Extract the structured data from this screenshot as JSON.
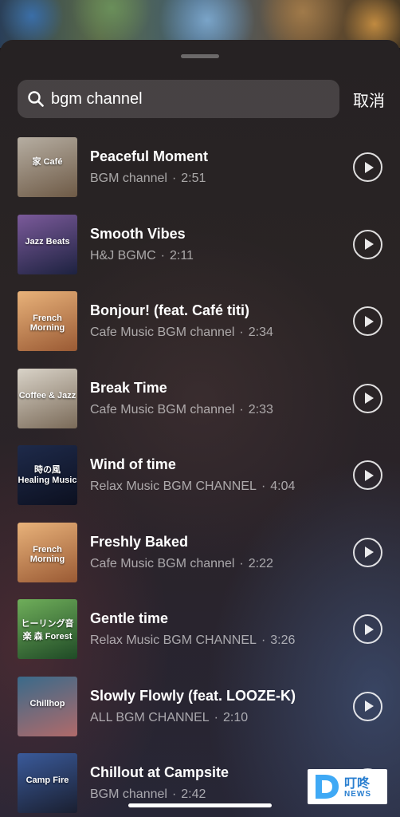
{
  "search": {
    "query": "bgm channel",
    "cancel_label": "取消"
  },
  "songs": [
    {
      "title": "Peaceful Moment",
      "artist": "BGM channel",
      "duration": "2:51",
      "cover_text": "家 Café",
      "cover_colors": [
        "#b6aea2",
        "#6e5a46"
      ]
    },
    {
      "title": "Smooth Vibes",
      "artist": "H&J BGMC",
      "duration": "2:11",
      "cover_text": "Jazz Beats",
      "cover_colors": [
        "#7b5a9a",
        "#1d2240"
      ]
    },
    {
      "title": "Bonjour! (feat. Café titi)",
      "artist": "Cafe Music BGM channel",
      "duration": "2:34",
      "cover_text": "French Morning",
      "cover_colors": [
        "#e8b27a",
        "#9a5a34"
      ]
    },
    {
      "title": "Break Time",
      "artist": "Cafe Music BGM channel",
      "duration": "2:33",
      "cover_text": "Coffee & Jazz",
      "cover_colors": [
        "#d9d3c8",
        "#7a6a58"
      ]
    },
    {
      "title": "Wind of time",
      "artist": "Relax Music BGM CHANNEL",
      "duration": "4:04",
      "cover_text": "時の風 Healing Music",
      "cover_colors": [
        "#1e2a4a",
        "#0c1020"
      ]
    },
    {
      "title": "Freshly Baked",
      "artist": "Cafe Music BGM channel",
      "duration": "2:22",
      "cover_text": "French Morning",
      "cover_colors": [
        "#e8b27a",
        "#9a5a34"
      ]
    },
    {
      "title": "Gentle time",
      "artist": "Relax Music BGM CHANNEL",
      "duration": "3:26",
      "cover_text": "ヒーリング音楽 森 Forest",
      "cover_colors": [
        "#6fae5a",
        "#1f4a26"
      ]
    },
    {
      "title": "Slowly Flowly (feat. LOOZE-K)",
      "artist": "ALL BGM CHANNEL",
      "duration": "2:10",
      "cover_text": "Chillhop",
      "cover_colors": [
        "#3a6a8a",
        "#b06a6a"
      ]
    },
    {
      "title": "Chillout at Campsite",
      "artist": "BGM channel",
      "duration": "2:42",
      "cover_text": "Camp Fire",
      "cover_colors": [
        "#3a5a9a",
        "#1a1f30"
      ]
    }
  ],
  "separator": "·",
  "watermark": {
    "cn": "叮咚",
    "en": "NEWS"
  }
}
